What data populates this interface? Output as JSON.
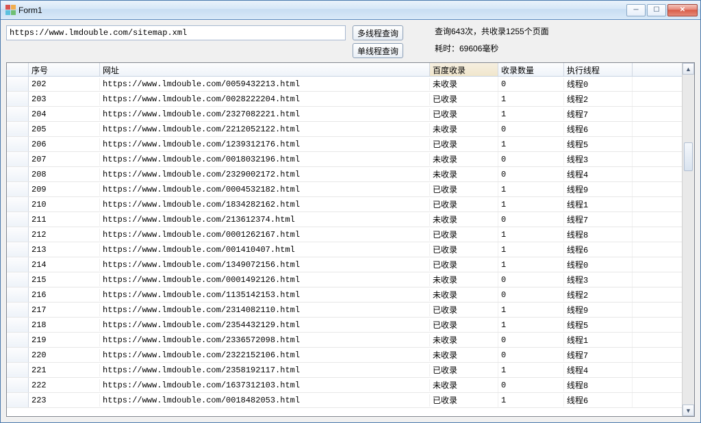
{
  "window": {
    "title": "Form1"
  },
  "toolbar": {
    "url_value": "https://www.lmdouble.com/sitemap.xml",
    "btn_multi": "多线程查询",
    "btn_single": "单线程查询"
  },
  "status": {
    "line1": "查询643次，共收录1255个页面",
    "line2": "耗时：69606毫秒"
  },
  "grid": {
    "columns": [
      "序号",
      "网址",
      "百度收录",
      "收录数量",
      "执行线程"
    ],
    "sorted_column_index": 2,
    "rows": [
      {
        "seq": "202",
        "url": "https://www.lmdouble.com/0059432213.html",
        "baidu": "未收录",
        "count": "0",
        "thread": "线程0"
      },
      {
        "seq": "203",
        "url": "https://www.lmdouble.com/0028222204.html",
        "baidu": "已收录",
        "count": "1",
        "thread": "线程2"
      },
      {
        "seq": "204",
        "url": "https://www.lmdouble.com/2327082221.html",
        "baidu": "已收录",
        "count": "1",
        "thread": "线程7"
      },
      {
        "seq": "205",
        "url": "https://www.lmdouble.com/2212052122.html",
        "baidu": "未收录",
        "count": "0",
        "thread": "线程6"
      },
      {
        "seq": "206",
        "url": "https://www.lmdouble.com/1239312176.html",
        "baidu": "已收录",
        "count": "1",
        "thread": "线程5"
      },
      {
        "seq": "207",
        "url": "https://www.lmdouble.com/0018032196.html",
        "baidu": "未收录",
        "count": "0",
        "thread": "线程3"
      },
      {
        "seq": "208",
        "url": "https://www.lmdouble.com/2329002172.html",
        "baidu": "未收录",
        "count": "0",
        "thread": "线程4"
      },
      {
        "seq": "209",
        "url": "https://www.lmdouble.com/0004532182.html",
        "baidu": "已收录",
        "count": "1",
        "thread": "线程9"
      },
      {
        "seq": "210",
        "url": "https://www.lmdouble.com/1834282162.html",
        "baidu": "已收录",
        "count": "1",
        "thread": "线程1"
      },
      {
        "seq": "211",
        "url": "https://www.lmdouble.com/213612374.html",
        "baidu": "未收录",
        "count": "0",
        "thread": "线程7"
      },
      {
        "seq": "212",
        "url": "https://www.lmdouble.com/0001262167.html",
        "baidu": "已收录",
        "count": "1",
        "thread": "线程8"
      },
      {
        "seq": "213",
        "url": "https://www.lmdouble.com/001410407.html",
        "baidu": "已收录",
        "count": "1",
        "thread": "线程6"
      },
      {
        "seq": "214",
        "url": "https://www.lmdouble.com/1349072156.html",
        "baidu": "已收录",
        "count": "1",
        "thread": "线程0"
      },
      {
        "seq": "215",
        "url": "https://www.lmdouble.com/0001492126.html",
        "baidu": "未收录",
        "count": "0",
        "thread": "线程3"
      },
      {
        "seq": "216",
        "url": "https://www.lmdouble.com/1135142153.html",
        "baidu": "未收录",
        "count": "0",
        "thread": "线程2"
      },
      {
        "seq": "217",
        "url": "https://www.lmdouble.com/2314082110.html",
        "baidu": "已收录",
        "count": "1",
        "thread": "线程9"
      },
      {
        "seq": "218",
        "url": "https://www.lmdouble.com/2354432129.html",
        "baidu": "已收录",
        "count": "1",
        "thread": "线程5"
      },
      {
        "seq": "219",
        "url": "https://www.lmdouble.com/2336572098.html",
        "baidu": "未收录",
        "count": "0",
        "thread": "线程1"
      },
      {
        "seq": "220",
        "url": "https://www.lmdouble.com/2322152106.html",
        "baidu": "未收录",
        "count": "0",
        "thread": "线程7"
      },
      {
        "seq": "221",
        "url": "https://www.lmdouble.com/2358192117.html",
        "baidu": "已收录",
        "count": "1",
        "thread": "线程4"
      },
      {
        "seq": "222",
        "url": "https://www.lmdouble.com/1637312103.html",
        "baidu": "未收录",
        "count": "0",
        "thread": "线程8"
      },
      {
        "seq": "223",
        "url": "https://www.lmdouble.com/0018482053.html",
        "baidu": "已收录",
        "count": "1",
        "thread": "线程6"
      }
    ]
  }
}
